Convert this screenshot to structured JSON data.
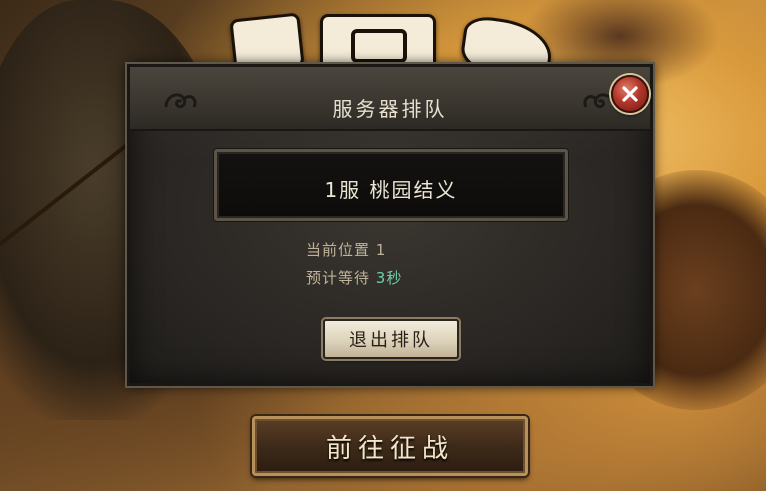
{
  "dialog": {
    "title": "服务器排队",
    "server_name": "1服 桃园结义",
    "queue_position": "当前位置 1",
    "wait_label": "预计等待 ",
    "wait_value": "3秒",
    "exit_button": "退出排队"
  },
  "main": {
    "go_battle_button": "前往征战"
  },
  "icons": {
    "close": "close-icon",
    "ornaments": "cloud-scroll-ornament"
  },
  "colors": {
    "accent_close": "#b2362a",
    "wait_value": "#6fd0a8",
    "title_text": "#e7e0cf"
  }
}
